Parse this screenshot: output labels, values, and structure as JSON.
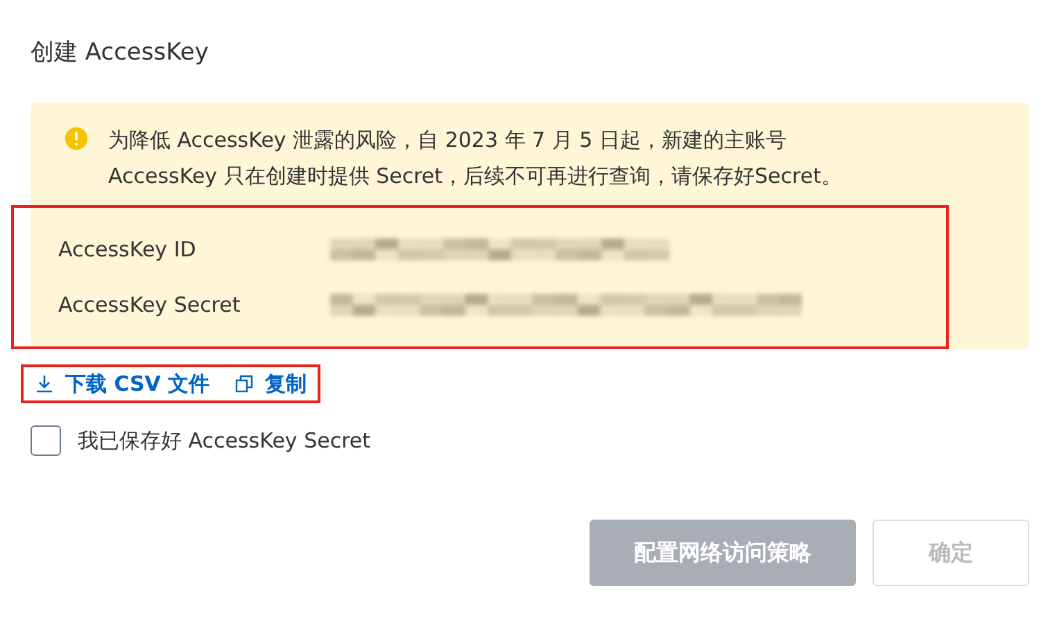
{
  "dialog": {
    "title": "创建 AccessKey"
  },
  "notice": {
    "kind": "warning",
    "text": "为降低 AccessKey 泄露的风险，自 2023 年 7 月 5 日起，新建的主账号 AccessKey 只在创建时提供 Secret，后续不可再进行查询，请保存好Secret。"
  },
  "credentials": {
    "highlighted": true,
    "rows": [
      {
        "label": "AccessKey ID",
        "value_redacted": true
      },
      {
        "label": "AccessKey Secret",
        "value_redacted": true
      }
    ]
  },
  "actions": {
    "highlighted": true,
    "links": [
      {
        "kind": "download",
        "label": "下载 CSV 文件"
      },
      {
        "kind": "copy",
        "label": "复制"
      }
    ]
  },
  "confirm_checkbox": {
    "label": "我已保存好 AccessKey Secret",
    "checked": false
  },
  "buttons": [
    {
      "label": "配置网络访问策略",
      "kind": "primary",
      "disabled": true
    },
    {
      "label": "确定",
      "kind": "secondary",
      "disabled": true
    }
  ]
}
